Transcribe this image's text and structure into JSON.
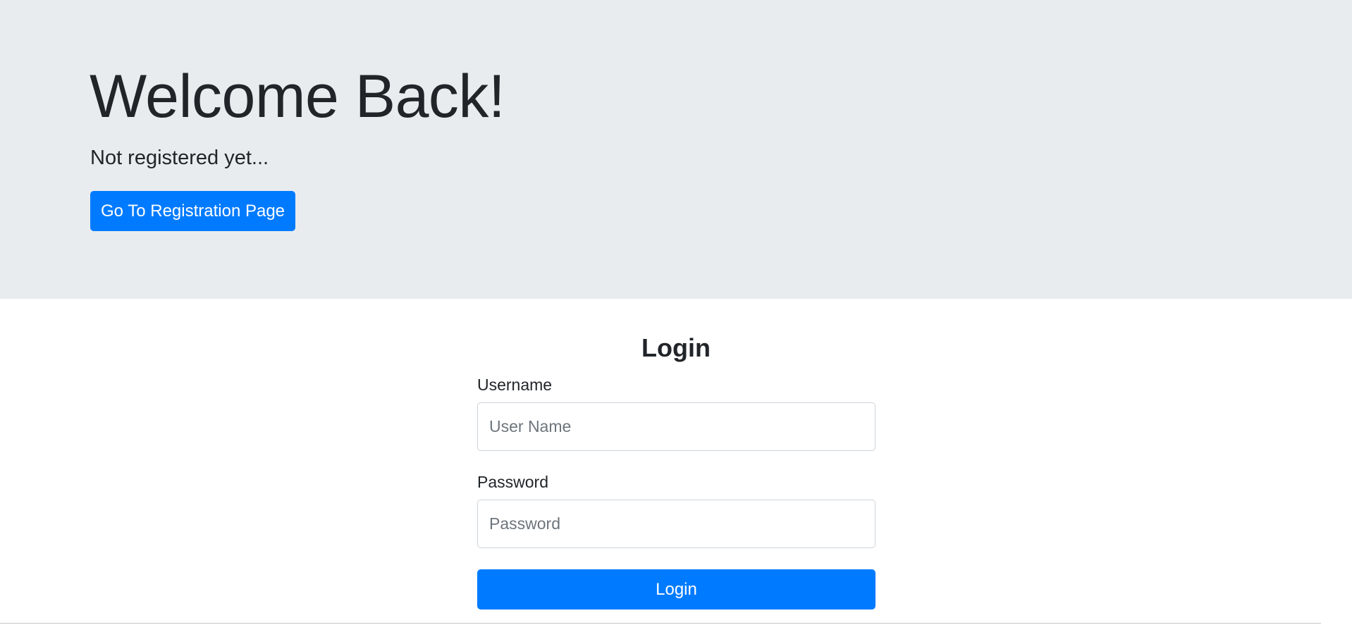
{
  "hero": {
    "title": "Welcome Back!",
    "subtitle": "Not registered yet...",
    "register_button": "Go To Registration Page"
  },
  "login": {
    "title": "Login",
    "username_label": "Username",
    "username_placeholder": "User Name",
    "username_value": "",
    "password_label": "Password",
    "password_placeholder": "Password",
    "password_value": "",
    "submit_label": "Login"
  },
  "colors": {
    "primary": "#007bff",
    "hero_background": "#e9ecef",
    "text": "#212529",
    "input_border": "#ced4da"
  }
}
